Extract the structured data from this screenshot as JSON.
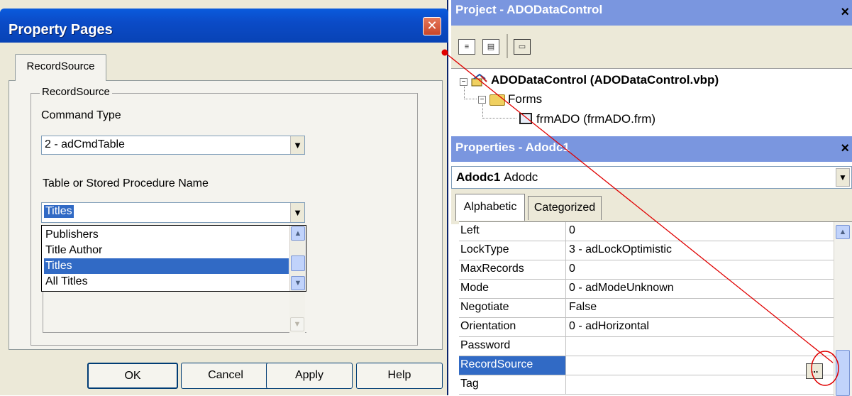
{
  "dialog": {
    "title": "Property Pages",
    "close_glyph": "✕",
    "tab_label": "RecordSource",
    "group_label": "RecordSource",
    "command_type_label": "Command Type",
    "command_type_value": "2 - adCmdTable",
    "table_label": "Table or Stored Procedure Name",
    "table_value": "Titles",
    "table_options": [
      "Publishers",
      "Title Author",
      "Titles",
      "All Titles"
    ],
    "selected_option": "Titles",
    "buttons": {
      "ok": "OK",
      "cancel": "Cancel",
      "apply": "Apply",
      "help": "Help"
    }
  },
  "project": {
    "title": "Project - ADODataControl",
    "close_glyph": "×",
    "toolbar_icons": [
      "view-code-icon",
      "view-object-icon",
      "toggle-folders-icon"
    ],
    "tree": {
      "project_label": "ADODataControl (ADODataControl.vbp)",
      "folder_label": "Forms",
      "form_label": "frmADO (frmADO.frm)"
    }
  },
  "properties": {
    "title": "Properties - Adodc1",
    "close_glyph": "×",
    "object_name": "Adodc1",
    "object_type": "Adodc",
    "tabs": [
      "Alphabetic",
      "Categorized"
    ],
    "active_tab": "Alphabetic",
    "rows": [
      {
        "name": "Left",
        "value": "0"
      },
      {
        "name": "LockType",
        "value": "3 - adLockOptimistic"
      },
      {
        "name": "MaxRecords",
        "value": "0"
      },
      {
        "name": "Mode",
        "value": "0 - adModeUnknown"
      },
      {
        "name": "Negotiate",
        "value": "False"
      },
      {
        "name": "Orientation",
        "value": "0 - adHorizontal"
      },
      {
        "name": "Password",
        "value": ""
      },
      {
        "name": "RecordSource",
        "value": ""
      },
      {
        "name": "Tag",
        "value": ""
      }
    ],
    "selected_row": "RecordSource",
    "ellipsis_label": "..."
  },
  "annotation": {
    "color": "#e00000"
  }
}
